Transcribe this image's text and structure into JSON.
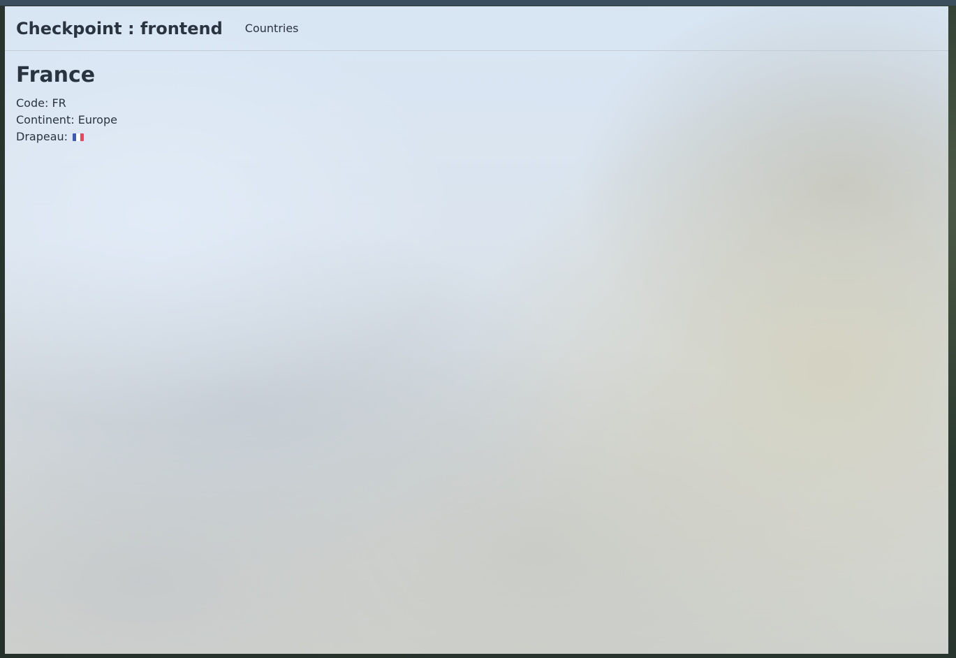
{
  "navbar": {
    "brand": "Checkpoint : frontend",
    "links": [
      {
        "label": "Countries"
      }
    ]
  },
  "country": {
    "name": "France",
    "code_label": "Code:",
    "code": "FR",
    "continent_label": "Continent:",
    "continent": "Europe",
    "flag_label": "Drapeau:",
    "flag_icon": "flag-france-icon",
    "flag_colors": [
      "#3f5bb5",
      "#ffffff",
      "#e8475a"
    ]
  }
}
